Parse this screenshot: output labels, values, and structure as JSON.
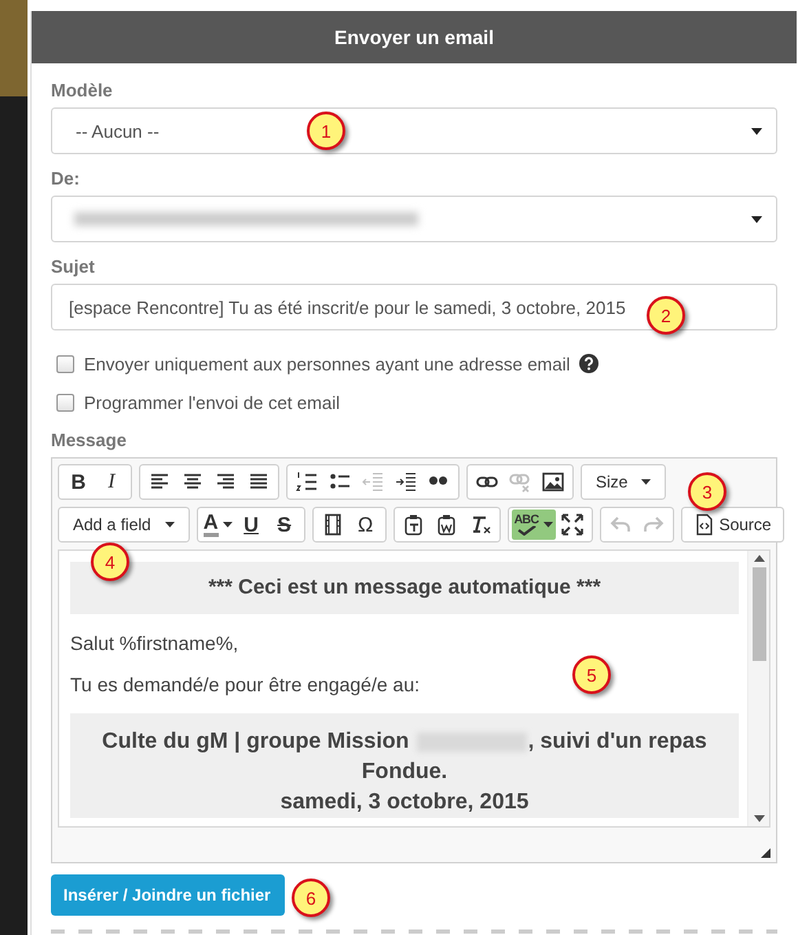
{
  "dialog": {
    "title": "Envoyer un email"
  },
  "template": {
    "label": "Modèle",
    "value": "-- Aucun --"
  },
  "sender": {
    "label": "De:"
  },
  "subject": {
    "label": "Sujet",
    "value": "[espace Rencontre] Tu as été inscrit/e pour le samedi, 3 octobre, 2015"
  },
  "options": [
    {
      "label": "Envoyer uniquement aux personnes ayant une adresse email",
      "checked": false,
      "help": true
    },
    {
      "label": "Programmer l'envoi de cet email",
      "checked": false,
      "help": false
    }
  ],
  "message": {
    "label": "Message",
    "toolbar_rows": [
      [
        [
          {
            "kind": "bold",
            "text": "B",
            "disabled": false,
            "on": false
          },
          {
            "kind": "italic",
            "text": "I",
            "disabled": false,
            "on": false
          }
        ],
        [
          {
            "kind": "align-left",
            "disabled": false,
            "on": false
          },
          {
            "kind": "align-center",
            "disabled": false,
            "on": false
          },
          {
            "kind": "align-right",
            "disabled": false,
            "on": false
          },
          {
            "kind": "justify",
            "disabled": false,
            "on": false
          }
        ],
        [
          {
            "kind": "numbered-list",
            "disabled": false,
            "on": false
          },
          {
            "kind": "bullet-list",
            "disabled": false,
            "on": false
          },
          {
            "kind": "outdent",
            "disabled": true,
            "on": false
          },
          {
            "kind": "indent",
            "disabled": false,
            "on": false
          },
          {
            "kind": "quote",
            "disabled": false,
            "on": false
          }
        ],
        [
          {
            "kind": "link",
            "disabled": false,
            "on": false
          },
          {
            "kind": "unlink",
            "disabled": true,
            "on": false
          },
          {
            "kind": "image",
            "disabled": false,
            "on": false
          }
        ],
        [
          {
            "kind": "dropdown",
            "text": "Size",
            "disabled": false,
            "on": false
          }
        ]
      ],
      [
        [
          {
            "kind": "dropdown",
            "text": "Add a field",
            "disabled": false,
            "on": false
          }
        ],
        [
          {
            "kind": "text-color",
            "text": "A",
            "disabled": false,
            "on": false
          },
          {
            "kind": "underline",
            "text": "U",
            "disabled": false,
            "on": false
          },
          {
            "kind": "strike",
            "text": "S",
            "disabled": false,
            "on": false
          }
        ],
        [
          {
            "kind": "film",
            "disabled": false,
            "on": false
          },
          {
            "kind": "symbol",
            "text": "Ω",
            "disabled": false,
            "on": false
          }
        ],
        [
          {
            "kind": "paste-text",
            "disabled": false,
            "on": false
          },
          {
            "kind": "paste-word",
            "disabled": false,
            "on": false
          },
          {
            "kind": "clear-format",
            "disabled": false,
            "on": false
          }
        ],
        [
          {
            "kind": "spellcheck",
            "text": "ABC",
            "disabled": false,
            "on": true
          },
          {
            "kind": "maximize",
            "disabled": false,
            "on": false
          }
        ],
        [
          {
            "kind": "undo",
            "disabled": true,
            "on": false
          },
          {
            "kind": "redo",
            "disabled": true,
            "on": false
          }
        ],
        [
          {
            "kind": "source",
            "text": "Source",
            "disabled": false,
            "on": false
          }
        ]
      ]
    ],
    "banner": "*** Ceci est un message automatique ***",
    "paragraphs": [
      "Salut %firstname%,",
      "Tu es demandé/e pour être engagé/e au:"
    ],
    "event": {
      "title_start": "Culte du gM | groupe Mission",
      "title_end": ", suivi d'un repas",
      "title_line2": "Fondue.",
      "date": "samedi, 3 octobre, 2015"
    }
  },
  "attach_button": "Insérer / Joindre un fichier",
  "callouts": [
    "1",
    "2",
    "3",
    "4",
    "5",
    "6"
  ]
}
